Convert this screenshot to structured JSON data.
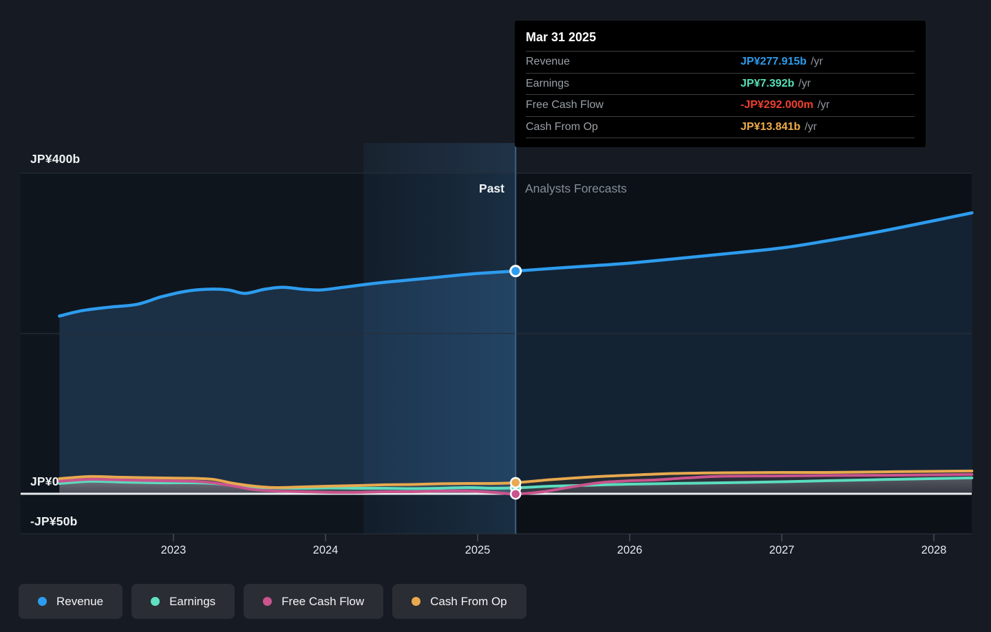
{
  "tooltip": {
    "date": "Mar 31 2025",
    "rows": [
      {
        "label": "Revenue",
        "value": "JP¥277.915b",
        "suffix": "/yr",
        "color": "#2D9CEE"
      },
      {
        "label": "Earnings",
        "value": "JP¥7.392b",
        "suffix": "/yr",
        "color": "#57DFB8"
      },
      {
        "label": "Free Cash Flow",
        "value": "-JP¥292.000m",
        "suffix": "/yr",
        "color": "#F0402F"
      },
      {
        "label": "Cash From Op",
        "value": "JP¥13.841b",
        "suffix": "/yr",
        "color": "#EFAD4A"
      }
    ]
  },
  "axis": {
    "y_labels": [
      {
        "text": "JP¥400b",
        "value": 400
      },
      {
        "text": "JP¥0",
        "value": 0
      },
      {
        "text": "-JP¥50b",
        "value": -50
      }
    ],
    "x_labels": [
      "2023",
      "2024",
      "2025",
      "2026",
      "2027",
      "2028"
    ]
  },
  "annotations": {
    "past_label": "Past",
    "forecast_label": "Analysts Forecasts"
  },
  "legend": [
    {
      "label": "Revenue",
      "color": "#2D9CEE"
    },
    {
      "label": "Earnings",
      "color": "#5FE0C1"
    },
    {
      "label": "Free Cash Flow",
      "color": "#C9548E"
    },
    {
      "label": "Cash From Op",
      "color": "#E8A94F"
    }
  ],
  "chart_data": {
    "type": "line",
    "x_unit": "year",
    "y_unit": "JP¥ billions",
    "ylim": [
      -50,
      400
    ],
    "xlim": [
      2022.1,
      2028.28
    ],
    "gridlines_y": [
      400,
      200,
      -50
    ],
    "zero_line": 0,
    "year_ticks": [
      2023,
      2024,
      2025,
      2026,
      2027,
      2028
    ],
    "past_forecast_boundary": 2025.25,
    "highlight_band": [
      2024.25,
      2025.25
    ],
    "legend_position": "bottom",
    "series": [
      {
        "name": "Revenue",
        "color": "#2D9CEE",
        "marker_x": 2025.25,
        "marker_value": 277.915,
        "points": [
          [
            2022.25,
            221.7
          ],
          [
            2022.4,
            228.5
          ],
          [
            2022.58,
            232.8
          ],
          [
            2022.76,
            236.3
          ],
          [
            2022.92,
            245.7
          ],
          [
            2023.08,
            252.6
          ],
          [
            2023.22,
            255.2
          ],
          [
            2023.36,
            254.3
          ],
          [
            2023.47,
            250.0
          ],
          [
            2023.6,
            255.2
          ],
          [
            2023.72,
            257.7
          ],
          [
            2023.85,
            255.2
          ],
          [
            2023.97,
            254.3
          ],
          [
            2024.12,
            257.7
          ],
          [
            2024.3,
            262.0
          ],
          [
            2024.48,
            265.5
          ],
          [
            2024.67,
            268.9
          ],
          [
            2024.85,
            272.3
          ],
          [
            2025.0,
            274.9
          ],
          [
            2025.25,
            277.915
          ],
          [
            2025.48,
            281.0
          ],
          [
            2025.75,
            284.4
          ],
          [
            2026.0,
            287.8
          ],
          [
            2026.29,
            293.0
          ],
          [
            2026.61,
            299.0
          ],
          [
            2027.0,
            306.7
          ],
          [
            2027.29,
            315.3
          ],
          [
            2027.6,
            325.6
          ],
          [
            2027.92,
            337.6
          ],
          [
            2028.25,
            350.5
          ]
        ]
      },
      {
        "name": "Cash From Op",
        "color": "#E8A94F",
        "marker_x": 2025.25,
        "marker_value": 13.841,
        "points": [
          [
            2022.25,
            18.9
          ],
          [
            2022.45,
            21.5
          ],
          [
            2022.67,
            20.6
          ],
          [
            2022.9,
            19.8
          ],
          [
            2023.13,
            19.3
          ],
          [
            2023.26,
            18.0
          ],
          [
            2023.4,
            12.9
          ],
          [
            2023.53,
            9.5
          ],
          [
            2023.67,
            7.7
          ],
          [
            2023.85,
            8.6
          ],
          [
            2024.03,
            9.5
          ],
          [
            2024.21,
            10.3
          ],
          [
            2024.39,
            11.2
          ],
          [
            2024.57,
            11.6
          ],
          [
            2024.76,
            12.5
          ],
          [
            2024.94,
            12.9
          ],
          [
            2025.1,
            12.9
          ],
          [
            2025.25,
            13.841
          ],
          [
            2025.48,
            17.6
          ],
          [
            2025.75,
            21.0
          ],
          [
            2026.0,
            23.2
          ],
          [
            2026.29,
            25.3
          ],
          [
            2026.61,
            26.2
          ],
          [
            2027.0,
            26.6
          ],
          [
            2027.29,
            26.6
          ],
          [
            2027.74,
            27.5
          ],
          [
            2028.25,
            28.4
          ]
        ]
      },
      {
        "name": "Free Cash Flow",
        "color": "#C9548E",
        "marker_x": 2025.25,
        "marker_value": -0.292,
        "points": [
          [
            2022.25,
            15.5
          ],
          [
            2022.45,
            18.0
          ],
          [
            2022.67,
            17.2
          ],
          [
            2022.9,
            16.3
          ],
          [
            2023.13,
            15.5
          ],
          [
            2023.26,
            13.7
          ],
          [
            2023.4,
            9.5
          ],
          [
            2023.53,
            5.2
          ],
          [
            2023.67,
            3.4
          ],
          [
            2023.85,
            2.6
          ],
          [
            2024.03,
            1.7
          ],
          [
            2024.21,
            1.7
          ],
          [
            2024.39,
            2.6
          ],
          [
            2024.57,
            2.6
          ],
          [
            2024.76,
            3.4
          ],
          [
            2024.94,
            3.4
          ],
          [
            2025.1,
            1.7
          ],
          [
            2025.25,
            -0.292
          ],
          [
            2025.43,
            2.6
          ],
          [
            2025.62,
            8.6
          ],
          [
            2025.8,
            13.7
          ],
          [
            2026.0,
            16.3
          ],
          [
            2026.16,
            17.2
          ],
          [
            2026.38,
            19.8
          ],
          [
            2026.61,
            21.9
          ],
          [
            2027.0,
            22.3
          ],
          [
            2027.29,
            22.8
          ],
          [
            2027.74,
            23.2
          ],
          [
            2028.25,
            24.1
          ]
        ]
      },
      {
        "name": "Earnings",
        "color": "#5BDCBE",
        "marker_x": 2025.25,
        "marker_value": 7.392,
        "points": [
          [
            2022.25,
            12.9
          ],
          [
            2022.45,
            15.5
          ],
          [
            2022.67,
            14.6
          ],
          [
            2022.9,
            13.7
          ],
          [
            2023.13,
            13.7
          ],
          [
            2023.26,
            12.9
          ],
          [
            2023.4,
            10.3
          ],
          [
            2023.53,
            8.2
          ],
          [
            2023.67,
            7.3
          ],
          [
            2023.85,
            6.9
          ],
          [
            2024.03,
            7.3
          ],
          [
            2024.21,
            6.9
          ],
          [
            2024.39,
            6.9
          ],
          [
            2024.57,
            6.4
          ],
          [
            2024.76,
            6.9
          ],
          [
            2024.94,
            7.7
          ],
          [
            2025.1,
            6.9
          ],
          [
            2025.25,
            7.392
          ],
          [
            2025.48,
            9.4
          ],
          [
            2025.75,
            10.7
          ],
          [
            2026.0,
            12.0
          ],
          [
            2026.29,
            12.9
          ],
          [
            2026.61,
            13.7
          ],
          [
            2027.0,
            15.0
          ],
          [
            2027.29,
            16.3
          ],
          [
            2027.74,
            18.0
          ],
          [
            2028.25,
            19.8
          ]
        ]
      }
    ]
  }
}
